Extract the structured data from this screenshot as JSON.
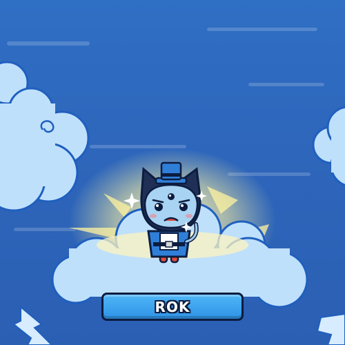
{
  "character": {
    "name": "ROK"
  },
  "colors": {
    "sky": "#2e66bb",
    "cloud": "#bfe0fb",
    "cloud_outline": "#1f5fbf",
    "glow": "#fff6b0",
    "name_plate": "#3aa6f0",
    "outline": "#0c1c3f"
  },
  "icons": {
    "character": "three-eyed-blue-cat-creature-with-top-hat",
    "sparkle": "sparkle-icon",
    "lightning": "lightning-bolt-icon"
  }
}
